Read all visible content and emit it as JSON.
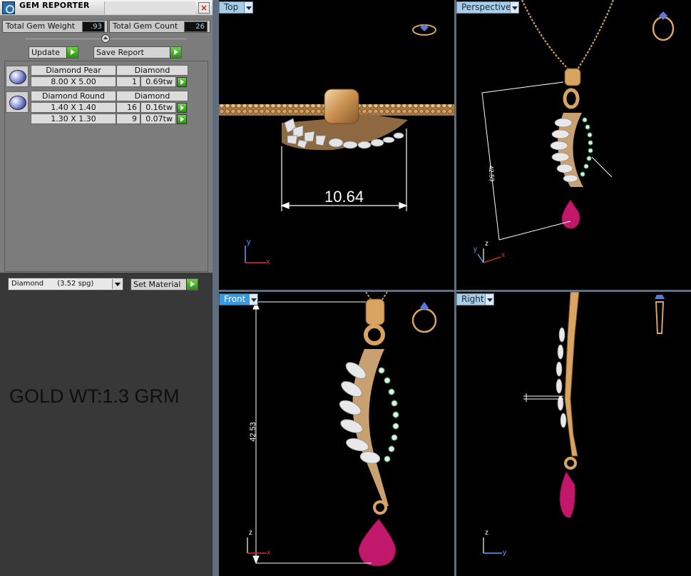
{
  "app": {
    "title": "GEM REPORTER"
  },
  "stats": {
    "total_weight_label": "Total Gem Weight",
    "total_weight_value": ".93",
    "total_count_label": "Total Gem Count",
    "total_count_value": "26"
  },
  "actions": {
    "update_label": "Update",
    "save_report_label": "Save Report"
  },
  "gems": [
    {
      "shape": "Diamond Pear",
      "material": "Diamond",
      "rows": [
        {
          "size": "8.00 X 5.00",
          "count": "1",
          "weight": "0.69tw"
        }
      ]
    },
    {
      "shape": "Diamond Round",
      "material": "Diamond",
      "rows": [
        {
          "size": "1.40 X 1.40",
          "count": "16",
          "weight": "0.16tw"
        },
        {
          "size": "1.30 X 1.30",
          "count": "9",
          "weight": "0.07tw"
        }
      ]
    }
  ],
  "material": {
    "selected": "Diamond      (3.52 spg)",
    "set_label": "Set Material"
  },
  "note": "GOLD WT:1.3 GRM",
  "viewports": {
    "top": {
      "label": "Top",
      "dimension": "10.64",
      "axis_x": "x",
      "axis_y": "y"
    },
    "perspective": {
      "label": "Perspective",
      "dimension": "42.53",
      "axis_x": "x",
      "axis_y": "y",
      "axis_z": "z"
    },
    "front": {
      "label": "Front",
      "dimension": "42.53",
      "axis_x": "x",
      "axis_z": "z"
    },
    "right": {
      "label": "Right",
      "axis_y": "y",
      "axis_z": "z"
    }
  },
  "colors": {
    "gold": "#d9a461",
    "ruby": "#c2186b",
    "diamond": "#e8e8ea",
    "emerald": "#2ea860",
    "accent_blue": "#3a9ade"
  }
}
